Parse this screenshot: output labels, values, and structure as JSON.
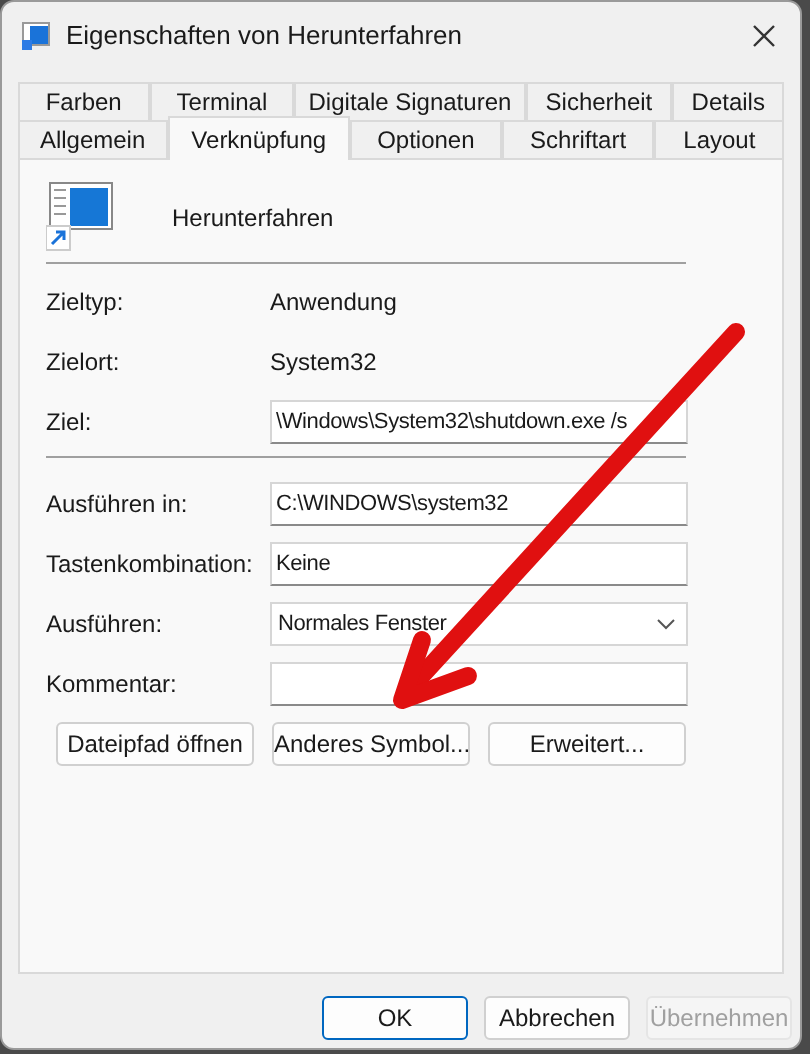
{
  "window": {
    "title": "Eigenschaften von Herunterfahren"
  },
  "tab_rows": [
    {
      "tabs": [
        {
          "label": "Farben",
          "selected": false
        },
        {
          "label": "Terminal",
          "selected": false
        },
        {
          "label": "Digitale Signaturen",
          "selected": false
        },
        {
          "label": "Sicherheit",
          "selected": false
        },
        {
          "label": "Details",
          "selected": false
        }
      ]
    },
    {
      "tabs": [
        {
          "label": "Allgemein",
          "selected": false
        },
        {
          "label": "Verknüpfung",
          "selected": true
        },
        {
          "label": "Optionen",
          "selected": false
        },
        {
          "label": "Schriftart",
          "selected": false
        },
        {
          "label": "Layout",
          "selected": false
        }
      ]
    }
  ],
  "shortcut_name": "Herunterfahren",
  "info_rows": [
    {
      "kind": "text",
      "label": "Zieltyp:",
      "value": "Anwendung"
    },
    {
      "kind": "text",
      "label": "Zielort:",
      "value": "System32"
    },
    {
      "kind": "field",
      "label": "Ziel:",
      "value": "\\Windows\\System32\\shutdown.exe /s"
    }
  ],
  "setting_rows": [
    {
      "kind": "field",
      "label": "Ausführen in:",
      "value": "C:\\WINDOWS\\system32"
    },
    {
      "kind": "field",
      "label": "Tastenkombination:",
      "value": "Keine"
    },
    {
      "kind": "dropdown",
      "label": "Ausführen:",
      "value": "Normales Fenster"
    },
    {
      "kind": "field",
      "label": "Kommentar:"
    }
  ],
  "action_buttons": [
    "Dateipfad öffnen",
    "Anderes Symbol...",
    "Erweitert..."
  ],
  "dialog_buttons": [
    {
      "label": "OK",
      "default": true,
      "disabled": false
    },
    {
      "label": "Abbrechen",
      "default": false,
      "disabled": false
    },
    {
      "label": "Übernehmen",
      "default": false,
      "disabled": true
    }
  ]
}
